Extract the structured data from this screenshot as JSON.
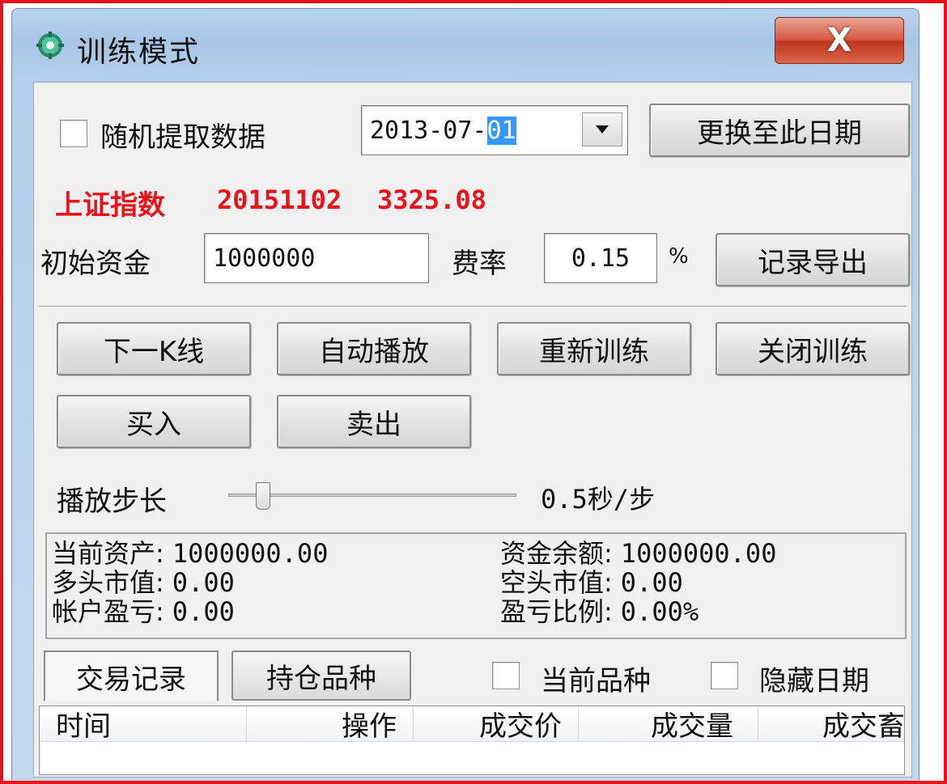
{
  "window": {
    "title": "训练模式",
    "close_label": "X"
  },
  "random_data": {
    "label": "随机提取数据",
    "checked": false
  },
  "date_picker": {
    "prefix": "2013-07-",
    "selected_day": "01",
    "dropdown_icon": "chevron-down-icon"
  },
  "change_date_button": "更换至此日期",
  "index_info": {
    "name": "上证指数",
    "date": "20151102",
    "value": "3325.08",
    "color": "#e8141c"
  },
  "capital": {
    "label": "初始资金",
    "value": "1000000"
  },
  "fee": {
    "label": "费率",
    "value": "0.15",
    "unit": "%"
  },
  "export_button": "记录导出",
  "actions": {
    "next_k": "下一K线",
    "auto_play": "自动播放",
    "restart": "重新训练",
    "close_training": "关闭训练",
    "buy": "买入",
    "sell": "卖出"
  },
  "playback": {
    "label": "播放步长",
    "value_text": "0.5秒/步",
    "level_fraction": 0.1
  },
  "stats": {
    "current_assets_label": "当前资产:",
    "current_assets": "1000000.00",
    "cash_balance_label": "资金余额:",
    "cash_balance": "1000000.00",
    "long_value_label": "多头市值:",
    "long_value": "0.00",
    "short_value_label": "空头市值:",
    "short_value": "0.00",
    "account_pl_label": "帐户盈亏:",
    "account_pl": "0.00",
    "pl_ratio_label": "盈亏比例:",
    "pl_ratio": "0.00%"
  },
  "tabs": {
    "trade_records": "交易记录",
    "positions": "持仓品种",
    "active": "trade_records"
  },
  "filters": {
    "current_symbol": "当前品种",
    "hide_date": "隐藏日期"
  },
  "table": {
    "columns": [
      "时间",
      "操作",
      "成交价",
      "成交量",
      "成交畜"
    ]
  }
}
